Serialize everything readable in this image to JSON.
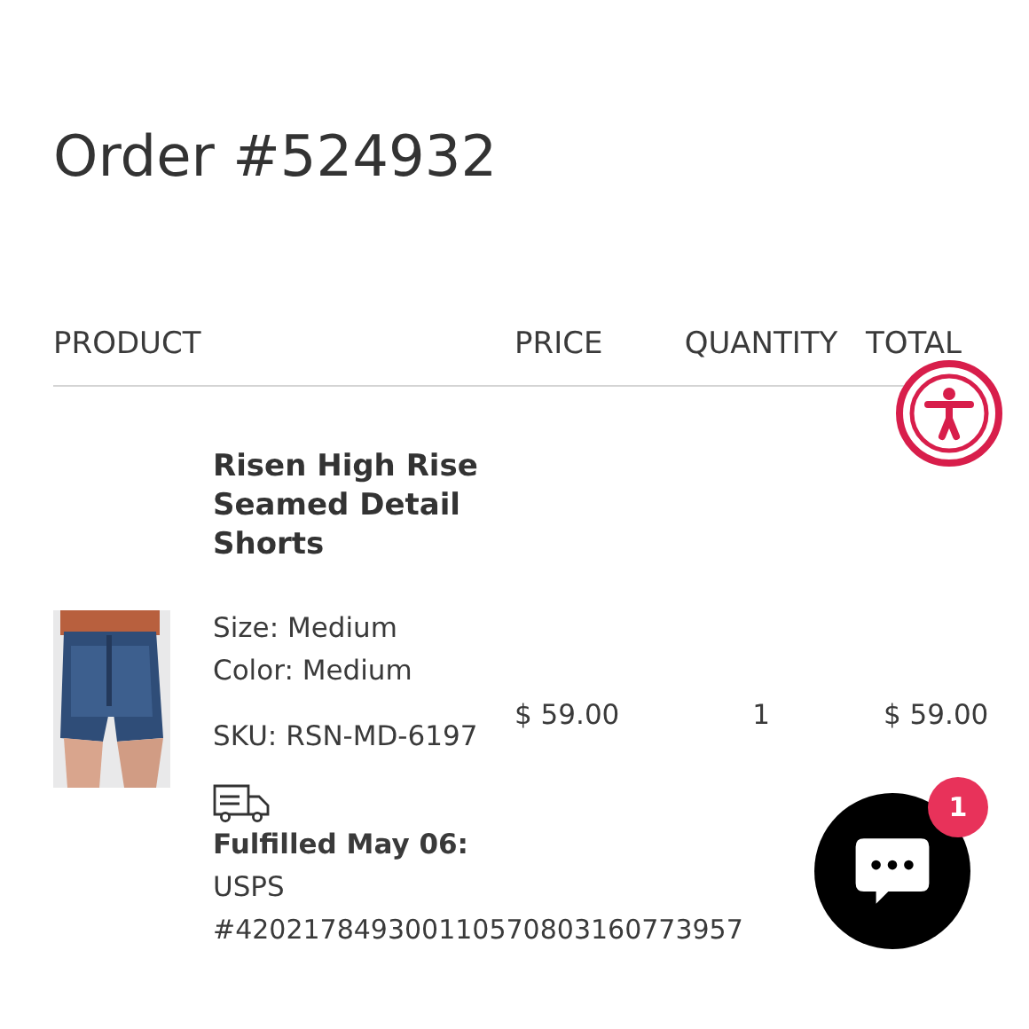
{
  "title": "Order #524932",
  "columns": [
    "PRODUCT",
    "PRICE",
    "QUANTITY",
    "TOTAL"
  ],
  "items": [
    {
      "name": "Risen High Rise Seamed Detail Shorts",
      "size": "Size: Medium",
      "color_option": "Color: Medium",
      "sku": "SKU: RSN-MD-6197",
      "price": "$ 59.00",
      "quantity": "1",
      "total": "$ 59.00",
      "fulfilled": "Fulfilled May 06:",
      "carrier": "USPS",
      "tracking": "#420217849300110570803160773957"
    }
  ],
  "chat": {
    "badge": "1"
  }
}
